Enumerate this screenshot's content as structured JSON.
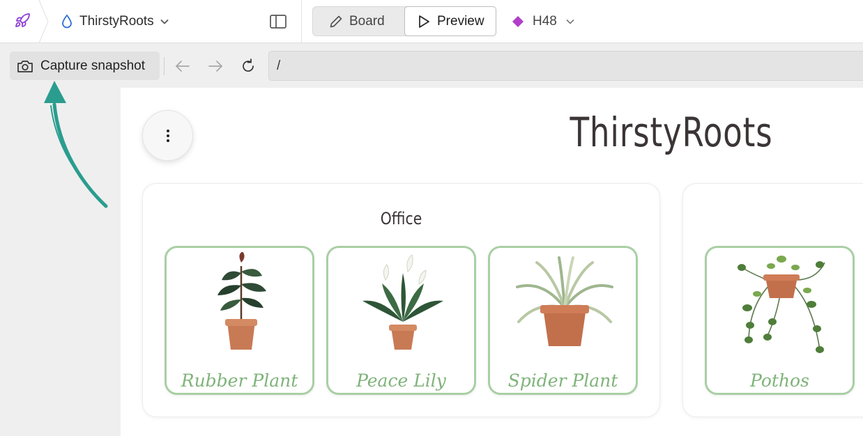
{
  "header": {
    "project_name": "ThirstyRoots",
    "modes": [
      {
        "label": "Board",
        "active": false
      },
      {
        "label": "Preview",
        "active": true
      }
    ],
    "branch": "H48",
    "branch_color": "#b13fc9",
    "accent_color": "#8e3ed6"
  },
  "toolbar": {
    "snapshot_label": "Capture snapshot",
    "url": "/"
  },
  "annotation": {
    "arrow_color": "#2a9d8f"
  },
  "app": {
    "title": "ThirstyRoots",
    "groups": [
      {
        "title": "Office",
        "plants": [
          {
            "name": "Rubber Plant",
            "icon": "rubber-plant-illustration"
          },
          {
            "name": "Peace Lily",
            "icon": "peace-lily-illustration"
          },
          {
            "name": "Spider Plant",
            "icon": "spider-plant-illustration"
          }
        ]
      },
      {
        "title": "",
        "plants": [
          {
            "name": "Pothos",
            "icon": "pothos-illustration"
          }
        ]
      }
    ],
    "card_border_color": "#a9cfa4",
    "plant_name_color": "#7fb37a"
  }
}
